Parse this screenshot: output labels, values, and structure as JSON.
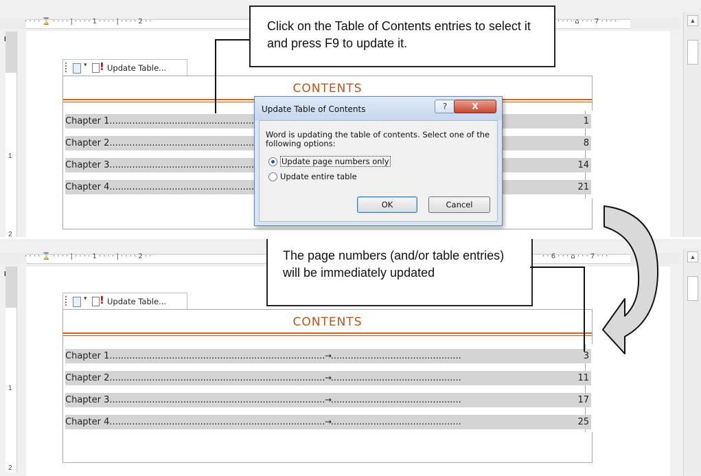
{
  "ruler": {
    "corner_glyph": "L",
    "left_marks": "· · · · ⌛ · · · · | · · · · 1 · · · · | · · · · 2 · ·",
    "right_marks_top": "· · · ·  ⌂ · · · 7 · · · ·",
    "right_marks_bottom": "· · 6 · · · ⌂ · · · 7 · · ·",
    "vertical_mark": "1",
    "vertical_mark2": "2"
  },
  "scrollbar": {
    "up_arrow_glyph": "▲"
  },
  "toc_tab": {
    "update_label": "Update Table...",
    "dropdown_glyph": "▾",
    "alert_glyph": "!"
  },
  "top_panel": {
    "contents_heading": "CONTENTS",
    "rows": [
      {
        "label": "Chapter 1.",
        "dots": "...........................................................................................................................",
        "page": "1"
      },
      {
        "label": "Chapter 2.",
        "dots": "...........................................................................................................................",
        "page": "8"
      },
      {
        "label": "Chapter 3.",
        "dots": "...........................................................................................................................",
        "page": "14"
      },
      {
        "label": "Chapter 4.",
        "dots": "...........................................................................................................................",
        "page": "21"
      }
    ]
  },
  "bottom_panel": {
    "contents_heading": "CONTENTS",
    "tab_arrow_glyph": "→",
    "rows": [
      {
        "label": "Chapter 1.",
        "dots": "...........................................................................................................................",
        "page": "3"
      },
      {
        "label": "Chapter 2.",
        "dots": "...........................................................................................................................",
        "page": "11"
      },
      {
        "label": "Chapter 3.",
        "dots": "...........................................................................................................................",
        "page": "17"
      },
      {
        "label": "Chapter 4.",
        "dots": "...........................................................................................................................",
        "page": "25"
      }
    ]
  },
  "dialog": {
    "title": "Update Table of Contents",
    "help_glyph": "?",
    "close_glyph": "X",
    "message": "Word is updating the table of contents.  Select one of the following options:",
    "option_page_numbers": "Update page numbers only",
    "option_entire_table": "Update entire table",
    "ok_label": "OK",
    "cancel_label": "Cancel"
  },
  "callouts": {
    "top": "Click on the Table of Contents entries to select it and press F9 to update it.",
    "bottom": "The page numbers (and/or table entries) will be immediately updated"
  },
  "colors": {
    "heading_orange": "#b8561d",
    "rule_orange": "#c8642a",
    "field_shading": "#d4d4d4",
    "dialog_blue": "#dbe6f3",
    "close_red": "#c9462e"
  }
}
